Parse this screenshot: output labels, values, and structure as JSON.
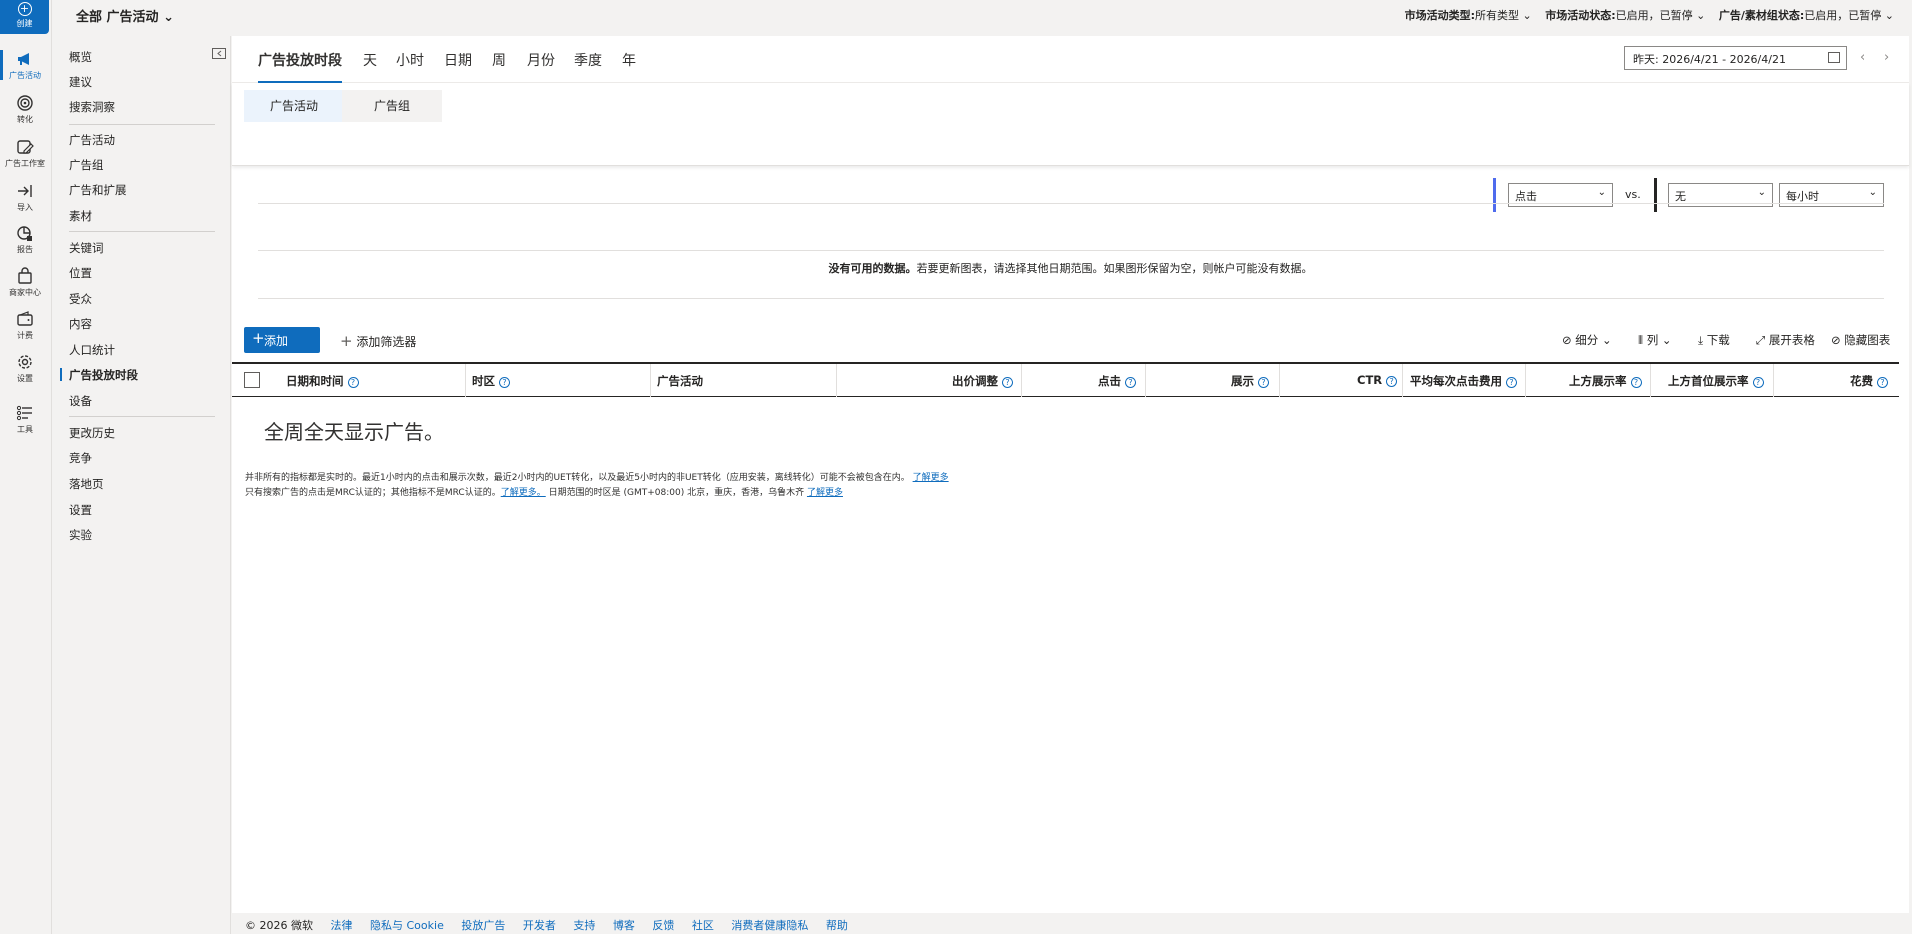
{
  "rail": {
    "create": "创建",
    "items": [
      "广告活动",
      "转化",
      "广告工作室",
      "导入",
      "报告",
      "商家中心",
      "计费",
      "设置",
      "工具"
    ]
  },
  "subnav": {
    "items": [
      "概览",
      "建议",
      "搜索洞察",
      "广告活动",
      "广告组",
      "广告和扩展",
      "素材",
      "关键词",
      "位置",
      "受众",
      "内容",
      "人口统计",
      "广告投放时段",
      "设备",
      "更改历史",
      "竞争",
      "落地页",
      "设置",
      "实验"
    ],
    "active": "广告投放时段"
  },
  "topbar": {
    "scope": "全部 广告活动",
    "filter1_label": "市场活动类型:",
    "filter1_value": "所有类型",
    "filter2_label": "市场活动状态:",
    "filter2_value": "已启用，已暂停",
    "filter3_label": "广告/素材组状态:",
    "filter3_value": "已启用，已暂停"
  },
  "tabs": [
    "广告投放时段",
    "天",
    "小时",
    "日期",
    "周",
    "月份",
    "季度",
    "年"
  ],
  "date_range": "昨天: 2026/4/21 - 2026/4/21",
  "segments": [
    "广告活动",
    "广告组"
  ],
  "chart": {
    "metric1": "点击",
    "vs": "vs.",
    "metric2": "无",
    "granularity": "每小时",
    "nodata_bold": "没有可用的数据。",
    "nodata_rest": "若要更新图表，请选择其他日期范围。如果图形保留为空，则帐户可能没有数据。"
  },
  "toolbar": {
    "add": "添加",
    "add_filter": "添加筛选器",
    "segment": "细分",
    "columns": "列",
    "download": "下载",
    "expand": "展开表格",
    "hide_chart": "隐藏图表"
  },
  "table": {
    "headers": [
      "日期和时间",
      "时区",
      "广告活动",
      "出价调整",
      "点击",
      "展示",
      "CTR",
      "平均每次点击费用",
      "上方展示率",
      "上方首位展示率",
      "花费"
    ],
    "empty": "全周全天显示广告。"
  },
  "notes": {
    "line1": "并非所有的指标都是实时的。最近1小时内的点击和展示次数，最近2小时内的UET转化，以及最近5小时内的非UET转化（应用安装，离线转化）可能不会被包含在内。",
    "line1_link": "了解更多",
    "line2a": "只有搜索广告的点击是MRC认证的；其他指标不是MRC认证的。",
    "line2_link1": "了解更多。",
    "line2b": "日期范围的时区是 (GMT+08:00) 北京，重庆，香港，乌鲁木齐",
    "line2_link2": "了解更多"
  },
  "footer": {
    "copyright": "© 2026 微软",
    "links": [
      "法律",
      "隐私与 Cookie",
      "投放广告",
      "开发者",
      "支持",
      "博客",
      "反馈",
      "社区",
      "消费者健康隐私",
      "帮助"
    ]
  },
  "colors": {
    "accent": "#0f6cbd",
    "metric1": "#4f6bed",
    "metric2": "#252423"
  }
}
